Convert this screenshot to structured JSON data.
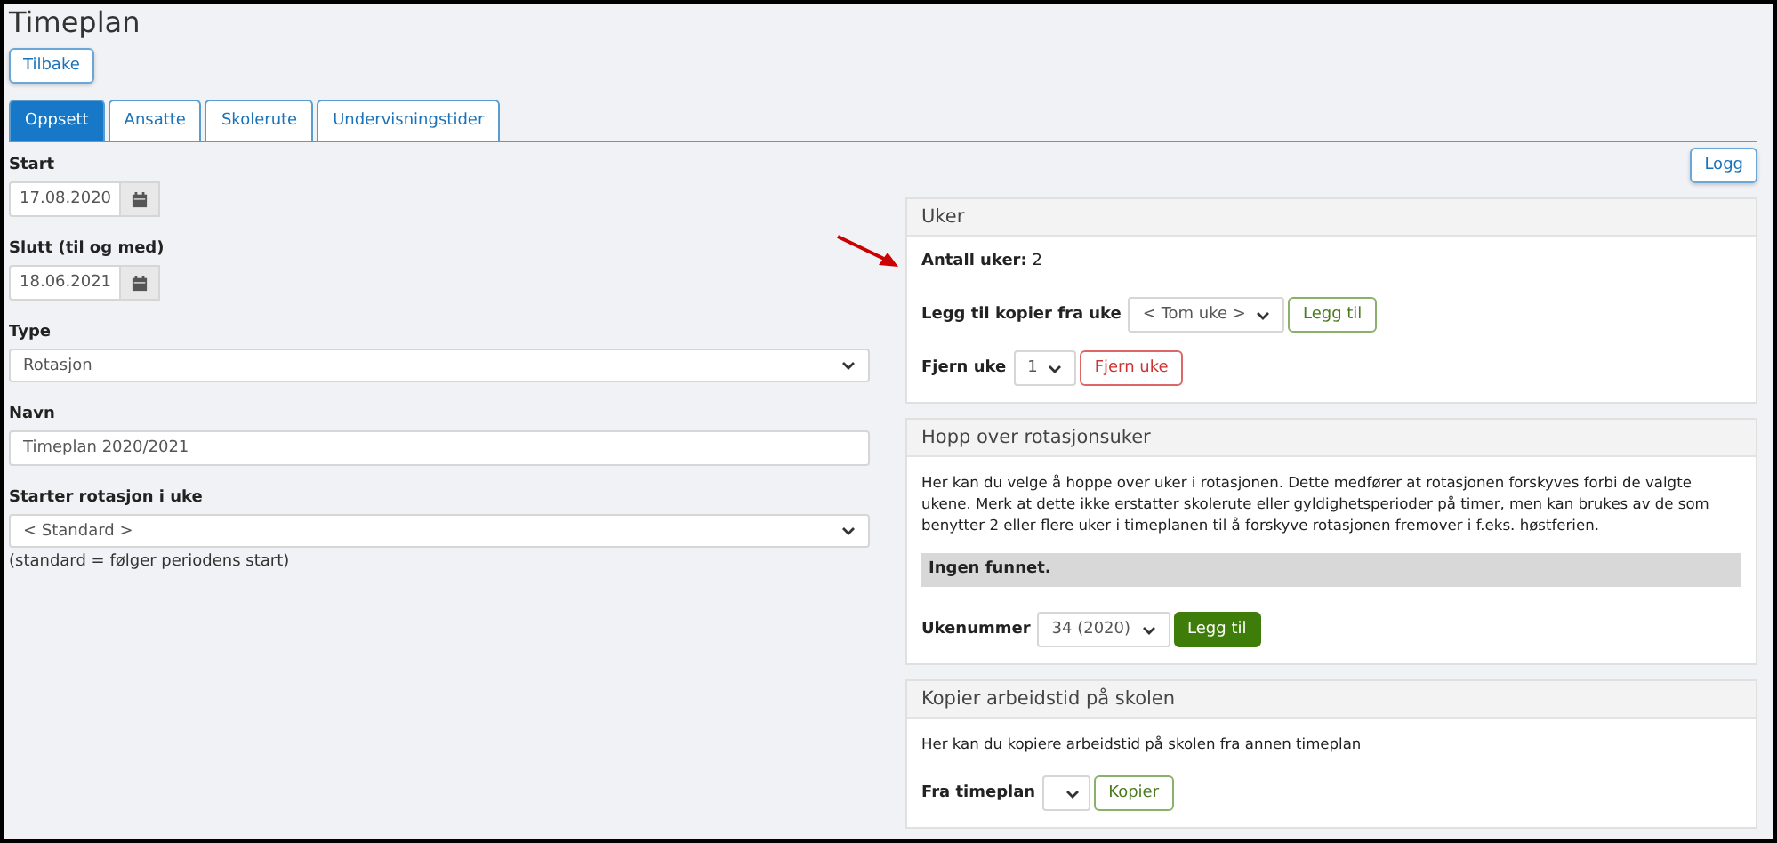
{
  "title": "Timeplan",
  "back_button": "Tilbake",
  "tabs": [
    {
      "label": "Oppsett",
      "selected": true
    },
    {
      "label": "Ansatte",
      "selected": false
    },
    {
      "label": "Skolerute",
      "selected": false
    },
    {
      "label": "Undervisningstider",
      "selected": false
    }
  ],
  "log_button": "Logg",
  "form": {
    "fields": [
      {
        "label": "Start",
        "kind": "date",
        "value": "17.08.2020"
      },
      {
        "label": "Slutt (til og med)",
        "kind": "date",
        "value": "18.06.2021"
      },
      {
        "label": "Type",
        "kind": "select",
        "value": "Rotasjon"
      },
      {
        "label": "Navn",
        "kind": "text",
        "value": "Timeplan 2020/2021"
      },
      {
        "label": "Starter rotasjon i uke",
        "kind": "select",
        "value": "< Standard >",
        "hint": "(standard = følger periodens start)"
      }
    ]
  },
  "weeks_panel": {
    "title": "Uker",
    "count": "**Antall uker:** 2",
    "copy_label": "Legg til kopier fra uke",
    "copy_select": "< Tom uke >",
    "add_button": "Legg til",
    "remove_label": "Fjern uke",
    "remove_select": "1",
    "remove_button": "Fjern uke"
  },
  "skip_panel": {
    "title": "Hopp over rotasjonsuker",
    "text": "Her kan du velge å hoppe over uker i rotasjonen. Dette medfører at rotasjonen forskyves forbi de valgte ukene. Merk at dette ikke erstatter skolerute eller gyldighetsperioder på timer, men kan brukes av de som benytter 2 eller flere uker i timeplanen til å forskyve rotasjonen fremover i f.eks. høstferien.",
    "empty": "Ingen funnet.",
    "week_label": "Ukenummer",
    "week_select": "34 (2020)",
    "add_button": "Legg til"
  },
  "copy_panel": {
    "title": "Kopier arbeidstid på skolen",
    "text": "Her kan du kopiere arbeidstid på skolen fra annen timeplan",
    "from_label": "Fra timeplan",
    "copy_button": "Kopier"
  }
}
